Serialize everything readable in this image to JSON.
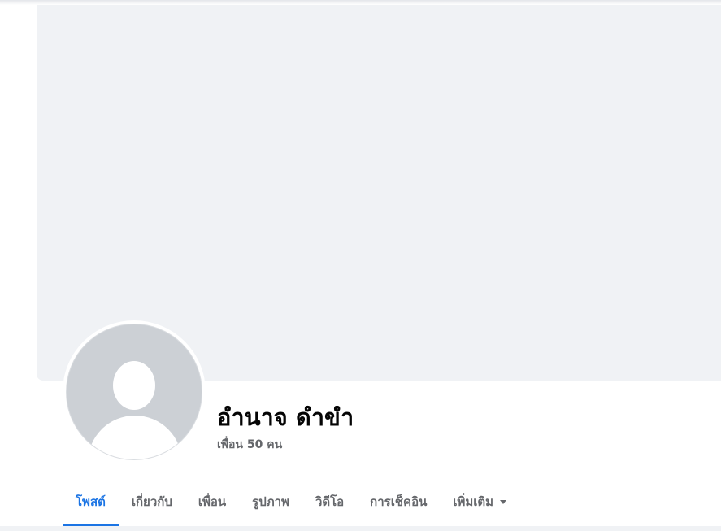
{
  "profile": {
    "name": "อำนาจ ดำขำ",
    "friends": "เพื่อน 50 คน"
  },
  "tabs": [
    {
      "label": "โพสต์",
      "active": true
    },
    {
      "label": "เกี่ยวกับ",
      "active": false
    },
    {
      "label": "เพื่อน",
      "active": false
    },
    {
      "label": "รูปภาพ",
      "active": false
    },
    {
      "label": "วิดีโอ",
      "active": false
    },
    {
      "label": "การเช็คอิน",
      "active": false
    },
    {
      "label": "เพิ่มเติม",
      "active": false,
      "icon": "caret-down-icon"
    }
  ],
  "colors": {
    "accent": "#1b74e4",
    "cover": "#f0f2f5",
    "avatar_bg": "#ccd0d5",
    "muted_text": "#65676b"
  }
}
